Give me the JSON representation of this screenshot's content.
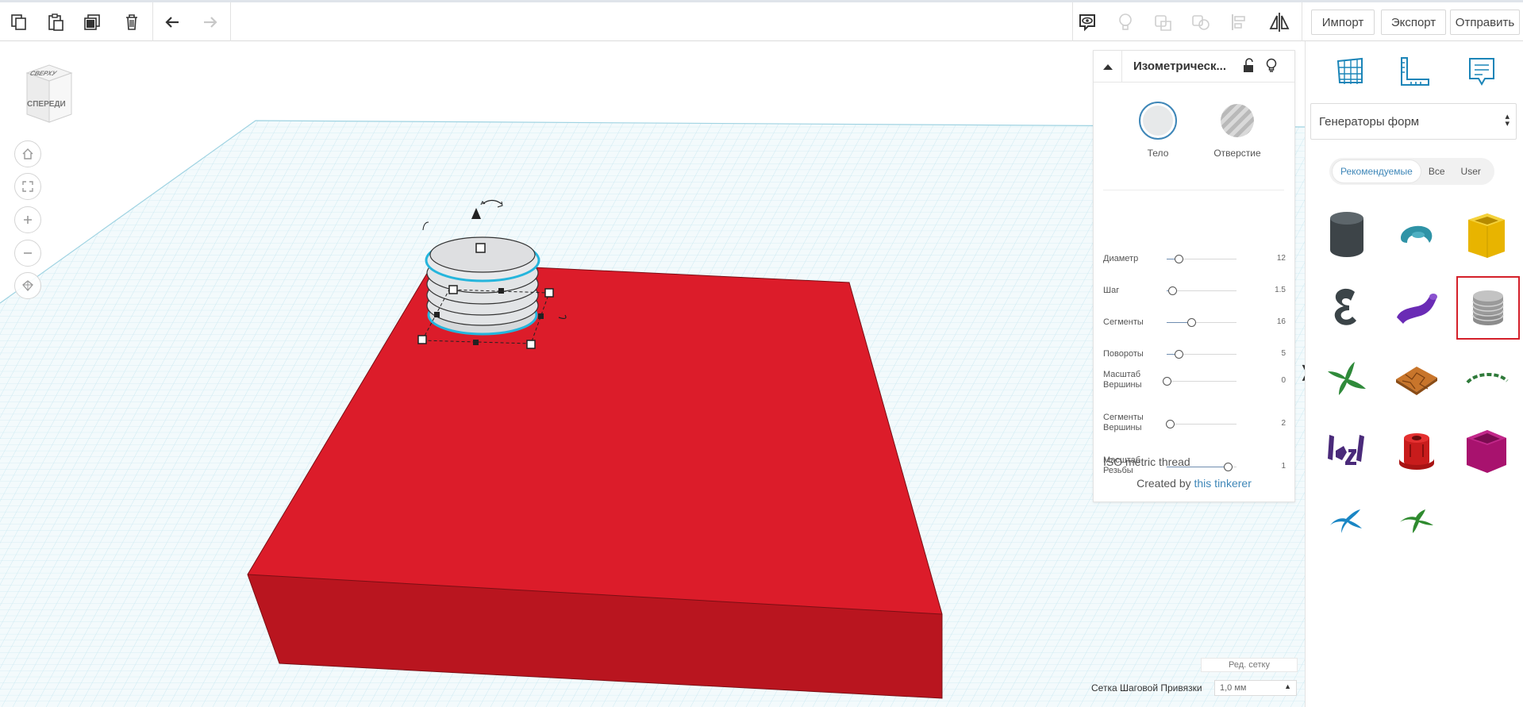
{
  "toolbar": {
    "left_icons": [
      "copy-icon",
      "paste-icon",
      "duplicate-icon",
      "trash-icon",
      "undo-icon",
      "redo-icon"
    ],
    "right_icons": [
      "show-all-icon",
      "light-bulb-icon",
      "group-icon",
      "ungroup-icon",
      "align-icon",
      "mirror-icon"
    ],
    "import_label": "Импорт",
    "export_label": "Экспорт",
    "send_label": "Отправить"
  },
  "viewcube": {
    "top_label": "СВЕРХУ",
    "front_label": "СПЕРЕДИ"
  },
  "inspector": {
    "title": "Изометрическ...",
    "solid_label": "Тело",
    "hole_label": "Отверстие",
    "params": [
      {
        "label": "Диаметр",
        "value": "12",
        "level": 0.17
      },
      {
        "label": "Шаг",
        "value": "1.5",
        "level": 0.08
      },
      {
        "label": "Сегменты",
        "value": "16",
        "level": 0.35
      },
      {
        "label": "Повороты",
        "value": "5",
        "level": 0.17
      },
      {
        "label": "Масштаб Вершины",
        "value": "0",
        "level": 0.0
      },
      {
        "label": "Сегменты Вершины",
        "value": "2",
        "level": 0.04
      },
      {
        "label": "Масштаб Резьбы",
        "value": "1",
        "level": 0.88
      }
    ],
    "footer_title": "ISO metric thread",
    "created_by": "Created by",
    "author": "this tinkerer"
  },
  "right_panel": {
    "tool_icons": [
      "grid-icon",
      "ruler-icon",
      "notes-icon"
    ],
    "category": "Генераторы форм",
    "tabs": [
      "Рекомендуемые",
      "Все",
      "User"
    ],
    "active_tab": "Рекомендуемые",
    "shapes": [
      "dark-cylinder-shape",
      "teal-torus-shape",
      "yellow-box-shape",
      "dark-e-shape",
      "purple-tube-shape",
      "threaded-cylinder-shape",
      "green-propeller-shape",
      "cracked-tile-shape",
      "green-arc-shape",
      "purple-text-shape",
      "red-connector-shape",
      "magenta-box-shape",
      "blue-propeller-shape",
      "green-propeller-2-shape"
    ]
  },
  "bottom": {
    "edit_grid": "Ред. сетку",
    "snap_label": "Сетка Шаговой Привязки",
    "snap_value": "1,0 мм"
  },
  "colors": {
    "accent": "#3f87b8",
    "red_box": "#d61f2b",
    "grid": "#bfe3ec",
    "selection_outline": "#25b5dc"
  }
}
